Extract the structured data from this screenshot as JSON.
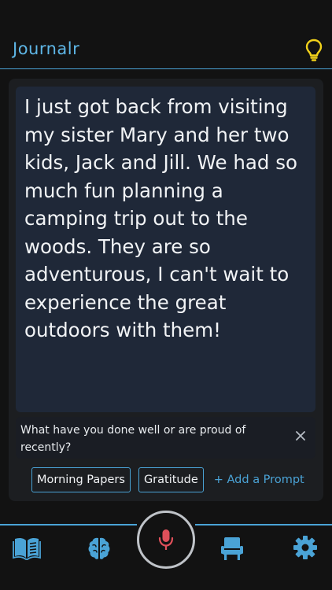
{
  "header": {
    "title": "Journalr",
    "icon": "lightbulb-icon"
  },
  "entry": {
    "text": "I just got back from visiting my sister Mary and her two kids, Jack and Jill. We had so much fun planning a camping trip out to the woods. They are so adventurous, I can't wait to experience the great outdoors with them!"
  },
  "prompt": {
    "text": "What have you done well or are proud of recently?",
    "close_icon": "close-icon"
  },
  "chips": [
    {
      "label": "Morning Papers"
    },
    {
      "label": "Gratitude"
    }
  ],
  "add_prompt_label": "+ Add a Prompt",
  "bottom_nav": {
    "items": [
      "journal-icon",
      "brain-icon",
      "microphone-icon",
      "chair-icon",
      "gear-icon"
    ]
  },
  "colors": {
    "accent": "#4aa3d6",
    "bulb": "#f2d21b",
    "mic": "#e0505a",
    "background": "#121212",
    "entry_background": "#1f2838"
  }
}
